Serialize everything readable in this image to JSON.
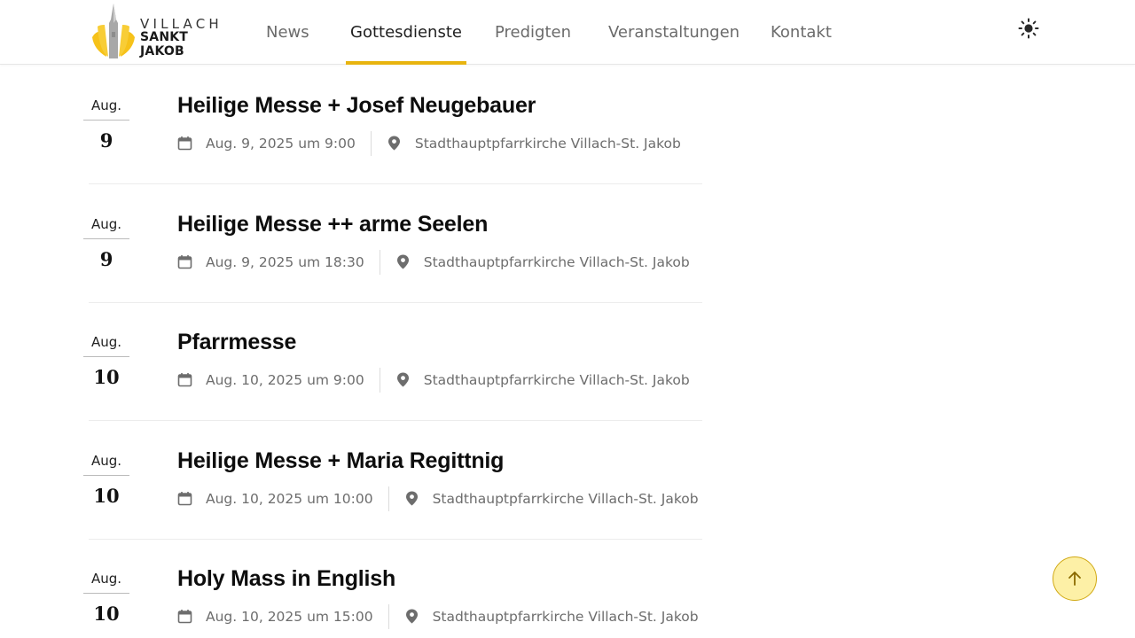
{
  "logo": {
    "line1": "VILLACH",
    "line2": "SANKT JAKOB"
  },
  "nav": [
    {
      "label": "News",
      "active": false
    },
    {
      "label": "Gottesdienste",
      "active": true
    },
    {
      "label": "Predigten",
      "active": false
    },
    {
      "label": "Veranstaltungen",
      "active": false
    },
    {
      "label": "Kontakt",
      "active": false
    }
  ],
  "icons": {
    "theme_toggle": "sun-icon",
    "date": "calendar-icon",
    "location": "map-pin-icon",
    "scroll_top": "arrow-up-icon"
  },
  "colors": {
    "accent": "#e8b40f",
    "scroll_button_bg": "#fdf0a6",
    "muted_text": "#6d6d6d"
  },
  "events": [
    {
      "month": "Aug.",
      "day": "9",
      "title": "Heilige Messe + Josef Neugebauer",
      "datetime": "Aug. 9, 2025 um 9:00",
      "location": "Stadthauptpfarrkirche Villach-St. Jakob"
    },
    {
      "month": "Aug.",
      "day": "9",
      "title": "Heilige Messe ++ arme Seelen",
      "datetime": "Aug. 9, 2025 um 18:30",
      "location": "Stadthauptpfarrkirche Villach-St. Jakob"
    },
    {
      "month": "Aug.",
      "day": "10",
      "title": "Pfarrmesse",
      "datetime": "Aug. 10, 2025 um 9:00",
      "location": "Stadthauptpfarrkirche Villach-St. Jakob"
    },
    {
      "month": "Aug.",
      "day": "10",
      "title": "Heilige Messe + Maria Regittnig",
      "datetime": "Aug. 10, 2025 um 10:00",
      "location": "Stadthauptpfarrkirche Villach-St. Jakob"
    },
    {
      "month": "Aug.",
      "day": "10",
      "title": "Holy Mass in English",
      "datetime": "Aug. 10, 2025 um 15:00",
      "location": "Stadthauptpfarrkirche Villach-St. Jakob"
    }
  ]
}
